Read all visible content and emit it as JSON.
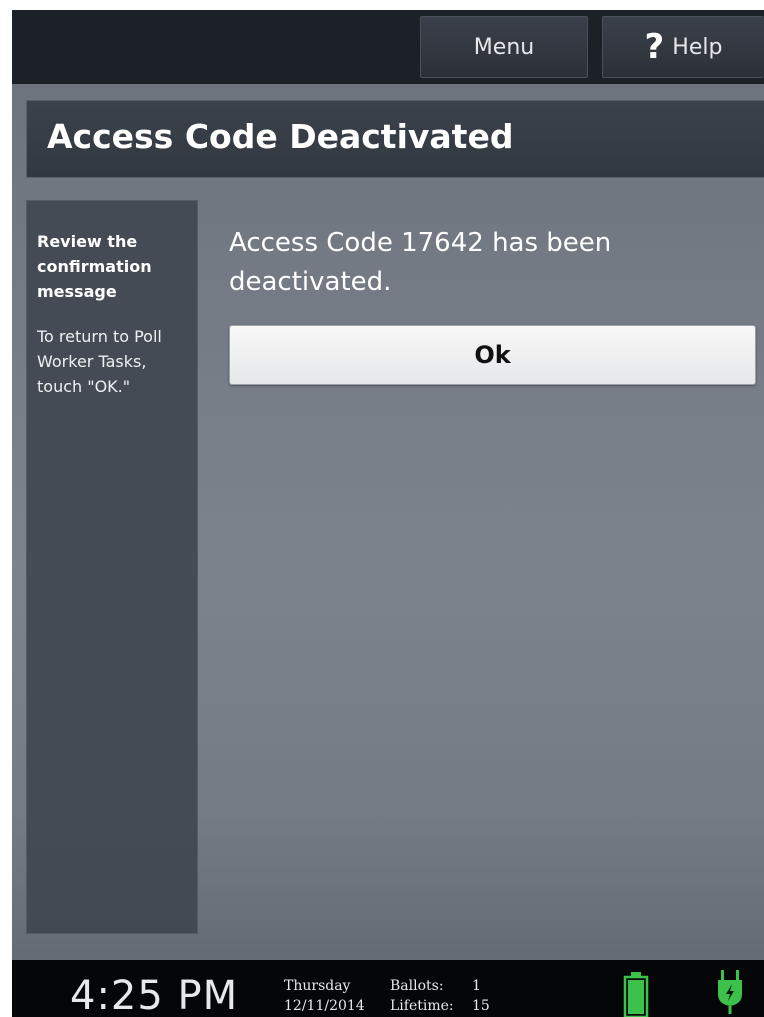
{
  "top_bar": {
    "menu_label": "Menu",
    "help_label": "Help",
    "help_icon": "question-mark-icon"
  },
  "header": {
    "title": "Access Code Deactivated"
  },
  "sidebar": {
    "heading": "Review the confirmation message",
    "instruction": "To return to Poll Worker Tasks, touch \"OK.\""
  },
  "main": {
    "message": "Access Code 17642 has been deactivated.",
    "ok_label": "Ok"
  },
  "status_bar": {
    "time": "4:25 PM",
    "weekday": "Thursday",
    "date": "12/11/2014",
    "ballots_label": "Ballots:",
    "ballots_value": "1",
    "lifetime_label": "Lifetime:",
    "lifetime_value": "15",
    "battery_icon": "battery-icon",
    "power_icon": "power-plug-icon"
  },
  "colors": {
    "status_green": "#3cc24a",
    "background": "#737a84",
    "bar": "#1c2127"
  }
}
